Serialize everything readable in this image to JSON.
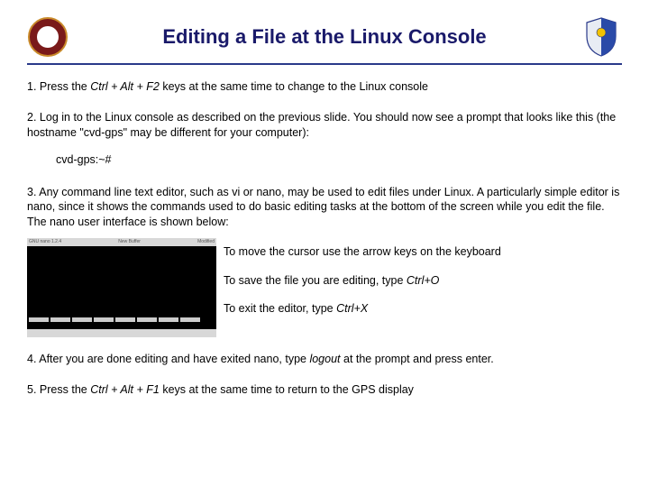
{
  "title": "Editing a File at the Linux Console",
  "logos": {
    "left": "university-seal",
    "right": "air-force-shield"
  },
  "steps": {
    "s1": {
      "num": "1.",
      "lead": "Press the ",
      "keys": "Ctrl + Alt + F2",
      "tail": " keys at the same time to change to the Linux console"
    },
    "s2": {
      "num": "2.",
      "text": "Log in to the Linux console as described on the previous slide. You should now see a prompt that looks like this (the hostname \"cvd-gps\" may be different for your computer):",
      "prompt": "cvd-gps:~#"
    },
    "s3": {
      "num": "3.",
      "text": "Any command line text editor, such as vi or nano, may be used to edit files under Linux. A particularly simple editor is nano,  since it shows the commands used to do basic editing tasks at the bottom of the screen while you edit the file. The nano user interface is shown below:"
    },
    "nano": {
      "title_left": "GNU nano 1.2.4",
      "title_center": "New Buffer",
      "title_right": "Modified",
      "note_move": "To move the cursor use the arrow keys on the keyboard",
      "note_save_pre": "To save the file you are editing, type ",
      "note_save_key": "Ctrl+O",
      "note_exit_pre": "To exit the editor, type ",
      "note_exit_key": "Ctrl+X"
    },
    "s4": {
      "num": "4.",
      "lead": "After you are done editing and have exited nano,  type ",
      "cmd": "logout",
      "tail": " at the prompt and press enter."
    },
    "s5": {
      "num": "5.",
      "lead": "Press the ",
      "keys": "Ctrl + Alt + F1",
      "tail": "  keys at the same time to return to the GPS display"
    }
  }
}
